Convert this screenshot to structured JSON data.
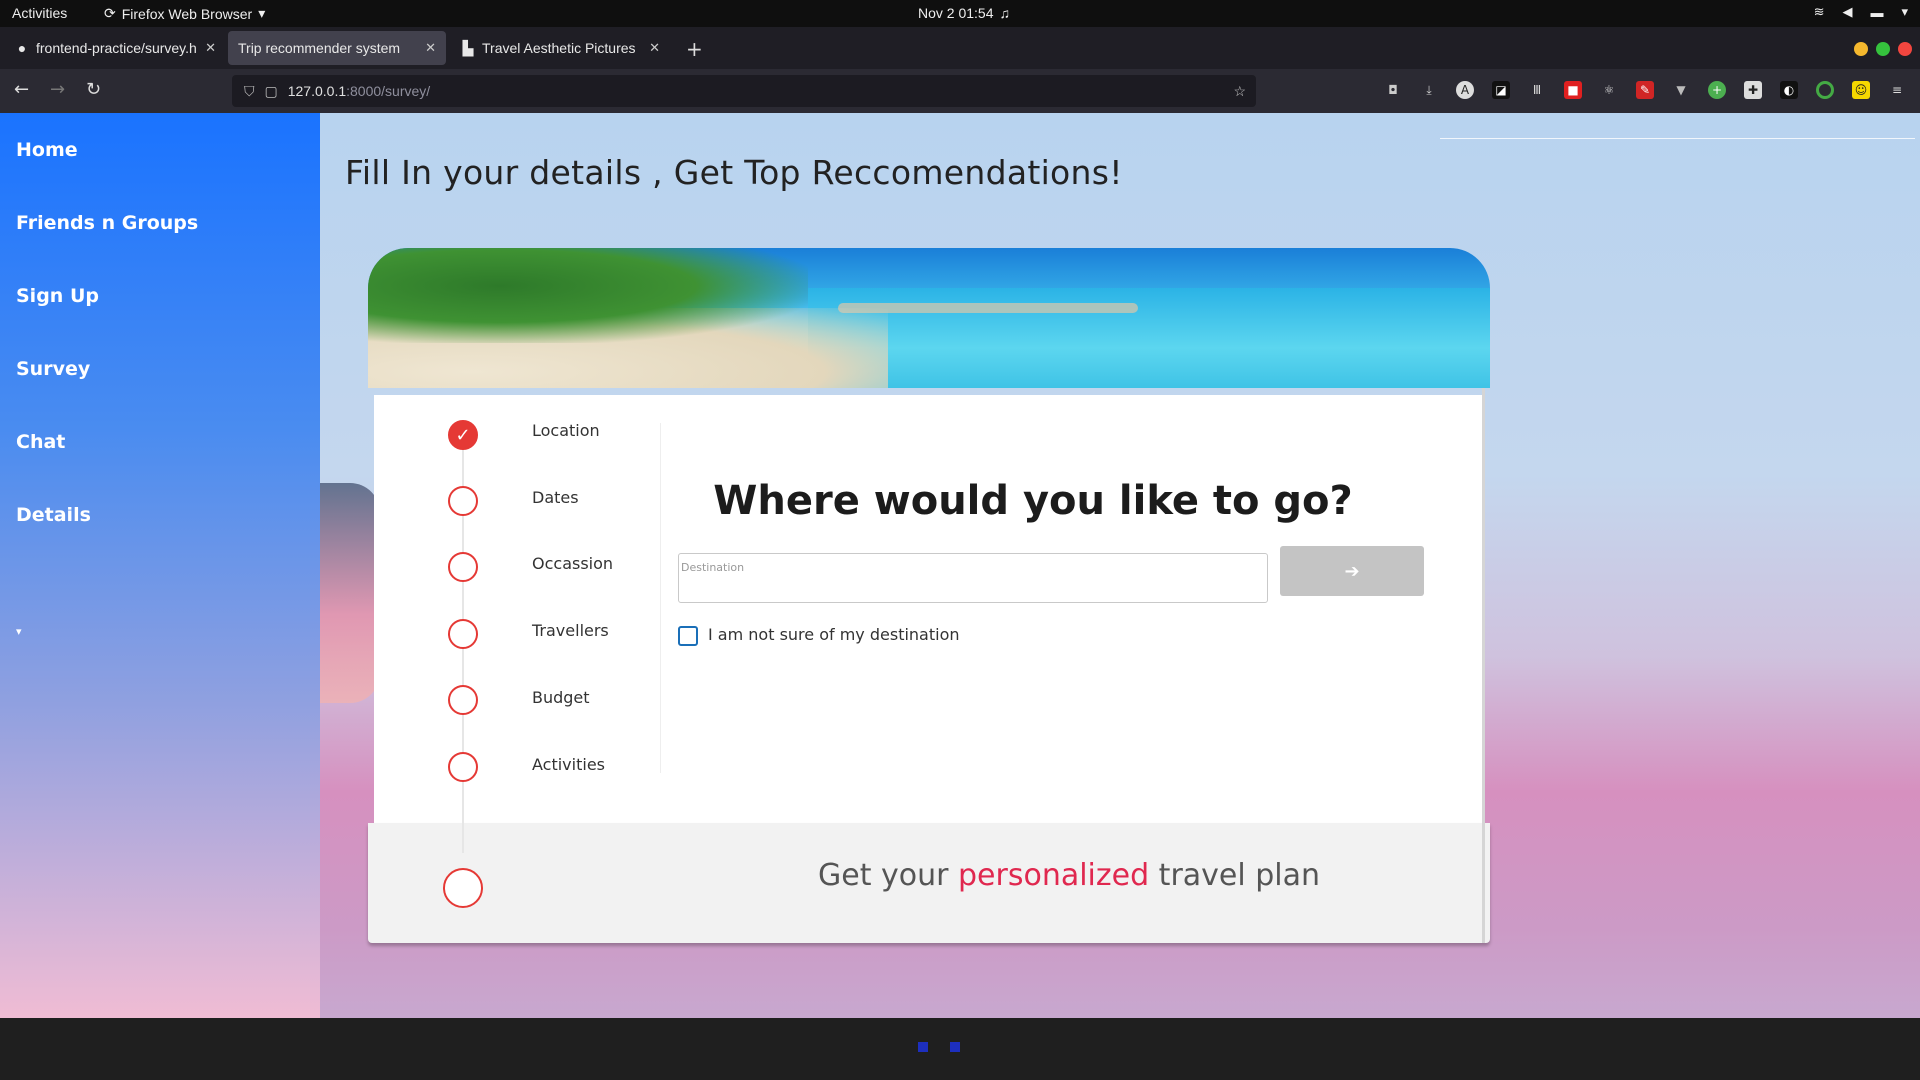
{
  "system_bar": {
    "activities": "Activities",
    "app_name": "Firefox Web Browser",
    "clock": "Nov 2  01:54"
  },
  "tabs": [
    {
      "label": "frontend-practice/survey.h",
      "active": false
    },
    {
      "label": "Trip recommender system",
      "active": true
    },
    {
      "label": "Travel Aesthetic Pictures",
      "active": false
    }
  ],
  "url": {
    "host": "127.0.0.1",
    "path": ":8000/survey/"
  },
  "sidebar": {
    "items": [
      {
        "label": "Home"
      },
      {
        "label": "Friends n Groups"
      },
      {
        "label": "Sign Up"
      },
      {
        "label": "Survey"
      },
      {
        "label": "Chat"
      },
      {
        "label": "Details"
      }
    ],
    "caret": "▾"
  },
  "page": {
    "heading": "Fill In your details , Get Top Reccomendations!"
  },
  "survey": {
    "steps": [
      {
        "label": "Location",
        "done": true
      },
      {
        "label": "Dates",
        "done": false
      },
      {
        "label": "Occassion",
        "done": false
      },
      {
        "label": "Travellers",
        "done": false
      },
      {
        "label": "Budget",
        "done": false
      },
      {
        "label": "Activities",
        "done": false
      }
    ],
    "question": "Where would you like to go?",
    "destination_placeholder": "Destination",
    "destination_value": "",
    "next_button": "➔",
    "not_sure_label": "I am not sure of my destination",
    "not_sure_checked": false,
    "tagline_prefix": "Get your ",
    "tagline_accent": "personalized",
    "tagline_suffix": " travel plan"
  },
  "colors": {
    "accent_red": "#e53935",
    "sidebar_top": "#1a73ff",
    "tagline_accent": "#e0284f"
  }
}
